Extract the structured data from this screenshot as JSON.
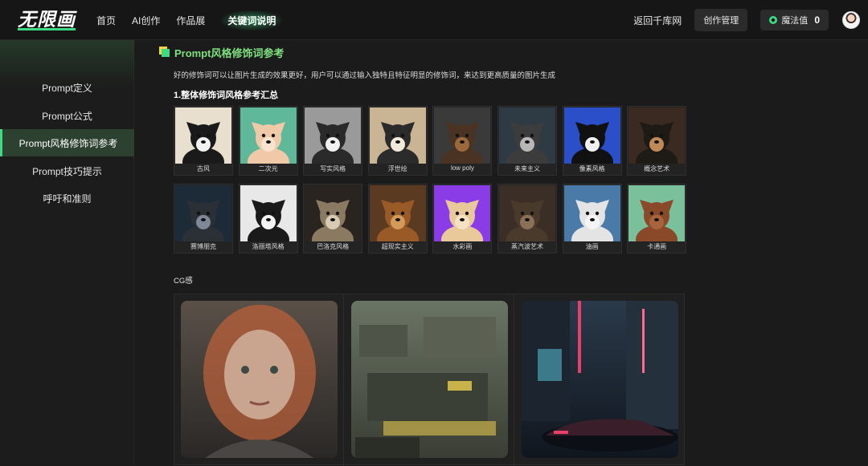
{
  "header": {
    "logo_text": "无限画",
    "nav": [
      "首页",
      "AI创作",
      "作品展",
      "关键词说明"
    ],
    "back_link": "返回千库网",
    "manage_button": "创作管理",
    "magic_label": "魔法值",
    "magic_value": "0"
  },
  "sidebar": {
    "items": [
      "Prompt定义",
      "Prompt公式",
      "Prompt风格修饰词参考",
      "Prompt技巧提示",
      "呼吁和准则"
    ],
    "active_index": 2
  },
  "content": {
    "title": "Prompt风格修饰词参考",
    "intro": "好的修饰词可以让图片生成的效果更好，用户可以通过输入独特且特征明显的修饰词，来达到更高质量的图片生成",
    "subheading": "1.整体修饰词风格参考汇总",
    "styles": [
      {
        "label": "古风",
        "bg": "#e9dfcf",
        "dog": "#1a1a1a",
        "face": "#f2f2f2"
      },
      {
        "label": "二次元",
        "bg": "#5fb89a",
        "dog": "#f0c9a8",
        "face": "#f7e3d0"
      },
      {
        "label": "写实风格",
        "bg": "#9a9a9a",
        "dog": "#2a2a2a",
        "face": "#f0f0f0"
      },
      {
        "label": "浮世绘",
        "bg": "#c9b494",
        "dog": "#2b2b2b",
        "face": "#f2ead8"
      },
      {
        "label": "low poly",
        "bg": "#3a3a3a",
        "dog": "#4a3322",
        "face": "#9a6a3c"
      },
      {
        "label": "未来主义",
        "bg": "#2e3a44",
        "dog": "#3c3c3c",
        "face": "#b7b7b7"
      },
      {
        "label": "像素风格",
        "bg": "#2a4fc9",
        "dog": "#111111",
        "face": "#f0f0f0"
      },
      {
        "label": "概念艺术",
        "bg": "#3a2a22",
        "dog": "#1e1a16",
        "face": "#c08a58"
      },
      {
        "label": "赛博朋克",
        "bg": "#1d2a38",
        "dog": "#2b2f36",
        "face": "#7e8896"
      },
      {
        "label": "洛丽塔风格",
        "bg": "#e8e8e8",
        "dog": "#1a1a1a",
        "face": "#f3f3f3"
      },
      {
        "label": "巴洛克风格",
        "bg": "#2a2420",
        "dog": "#8a7a62",
        "face": "#d8cbb4"
      },
      {
        "label": "超现实主义",
        "bg": "#5a3a20",
        "dog": "#9a5a28",
        "face": "#d49a5a"
      },
      {
        "label": "水彩画",
        "bg": "#8a3ce6",
        "dog": "#e9c89a",
        "face": "#f5e2c4"
      },
      {
        "label": "蒸汽波艺术",
        "bg": "#3a2e26",
        "dog": "#4a3a2c",
        "face": "#8a7058"
      },
      {
        "label": "油画",
        "bg": "#4a7aa8",
        "dog": "#e4e4e4",
        "face": "#f5f5f5"
      },
      {
        "label": "卡通画",
        "bg": "#7ac09a",
        "dog": "#8a4a2a",
        "face": "#a8653c"
      }
    ],
    "cg_label": "CG感",
    "cg_images": [
      {
        "name": "cg-portrait-image",
        "top": "#5a5048",
        "bottom": "#2a2826",
        "accent": "#b8603a"
      },
      {
        "name": "cg-city-ruins-image",
        "top": "#6a7464",
        "bottom": "#3a3e34",
        "accent": "#c9b24a"
      },
      {
        "name": "cg-neon-car-image",
        "top": "#2a3a4a",
        "bottom": "#10161e",
        "accent": "#e8406a"
      }
    ]
  }
}
